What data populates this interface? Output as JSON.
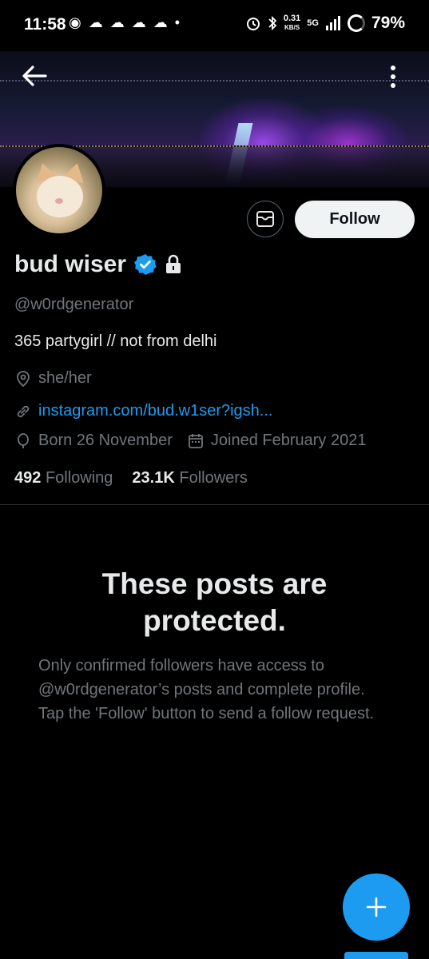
{
  "status_bar": {
    "time": "11:58",
    "notification_icons": "◉ ☁ ☁ ☁ ☁ •",
    "net_speed_value": "0.31",
    "net_speed_unit": "KB/S",
    "network_type": "5G",
    "battery": "79%"
  },
  "profile": {
    "display_name": "bud wiser",
    "verified": true,
    "protected": true,
    "handle": "@w0rdgenerator",
    "bio": "365 partygirl // not from delhi",
    "pronouns": "she/her",
    "link": "instagram.com/bud.w1ser?igsh...",
    "birthday": "Born 26 November",
    "joined": "Joined February 2021",
    "following_count": "492",
    "following_label": "Following",
    "followers_count": "23.1K",
    "followers_label": "Followers"
  },
  "actions": {
    "follow_label": "Follow",
    "message_icon": "mail-icon",
    "back_icon": "back-arrow-icon",
    "more_icon": "more-vertical-icon",
    "compose_icon": "plus-icon"
  },
  "protected_notice": {
    "title": "These posts are protected.",
    "description": "Only confirmed followers have access to @w0rdgenerator’s posts and complete profile. Tap the 'Follow' button to send a follow request."
  },
  "colors": {
    "background": "#000000",
    "accent": "#1d9bf0",
    "secondary_text": "#71767b",
    "primary_text": "#e7e9ea"
  }
}
